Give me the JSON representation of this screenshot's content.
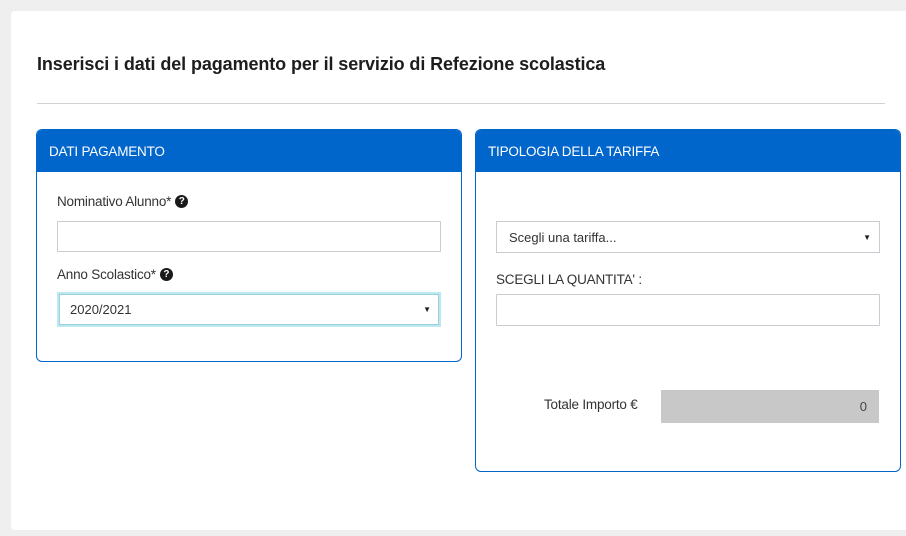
{
  "page": {
    "title": "Inserisci i dati del pagamento per il servizio di Refezione scolastica"
  },
  "left_panel": {
    "header": "DATI PAGAMENTO",
    "student_name_label": "Nominativo Alunno*",
    "student_name_value": "",
    "school_year_label": "Anno Scolastico*",
    "school_year_value": "2020/2021"
  },
  "right_panel": {
    "header": "TIPOLOGIA DELLA TARIFFA",
    "tariff_placeholder": "Scegli una tariffa...",
    "quantity_label": "SCEGLI LA QUANTITA' :",
    "quantity_value": "",
    "total_label": "Totale Importo €",
    "total_value": "0"
  },
  "icons": {
    "help": "question-circle-icon",
    "caret": "caret-down-icon"
  },
  "colors": {
    "accent": "#0066cc",
    "focus_border": "#bde8f1",
    "total_bg": "#c8c8c8"
  }
}
